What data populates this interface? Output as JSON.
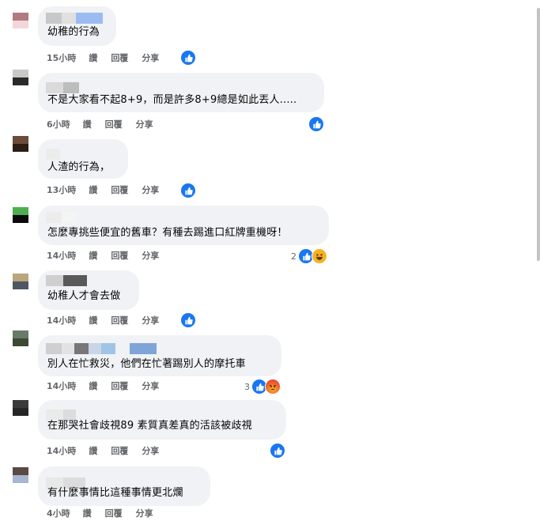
{
  "actions": {
    "like": "讚",
    "reply": "回覆",
    "share": "分享"
  },
  "colors": {
    "like_blue": "#1877f2",
    "bubble": "#f0f2f5",
    "meta_text": "#65676b"
  },
  "comments": [
    {
      "text": "幼稚的行為",
      "time": "15小時",
      "reaction_count": "",
      "reactions": [
        "like-icon"
      ]
    },
    {
      "text": "不是大家看不起8+9，而是許多8+9總是如此丟人.....",
      "time": "6小時",
      "reaction_count": "",
      "reactions": [
        "like-icon"
      ]
    },
    {
      "text": "人渣的行為，",
      "time": "13小時",
      "reaction_count": "",
      "reactions": [
        "like-icon"
      ]
    },
    {
      "text": "怎麼專挑些便宜的舊車？有種去踢進口紅牌重機呀！",
      "time": "14小時",
      "reaction_count": "2",
      "reactions": [
        "like-icon",
        "haha-icon"
      ]
    },
    {
      "text": "幼稚人才會去做",
      "time": "14小時",
      "reaction_count": "",
      "reactions": [
        "like-icon"
      ]
    },
    {
      "text": "別人在忙救災，他們在忙著踢別人的摩托車",
      "time": "14小時",
      "reaction_count": "3",
      "reactions": [
        "like-icon",
        "angry-icon"
      ]
    },
    {
      "text": "在那哭社會歧視89 素質真差真的活該被歧視",
      "time": "14小時",
      "reaction_count": "",
      "reactions": [
        "like-icon"
      ]
    },
    {
      "text": "有什麼事情比這種事情更北爛",
      "time": "4小時",
      "reaction_count": "",
      "reactions": []
    }
  ]
}
